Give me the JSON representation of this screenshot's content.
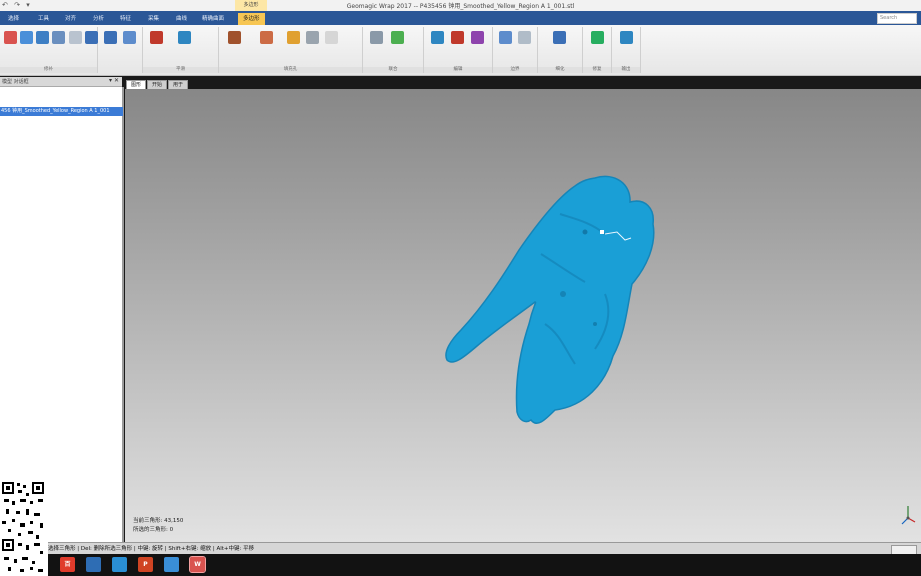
{
  "window": {
    "title": "Geomagic Wrap 2017 -- P435456 钟用_Smoothed_Yellow_Region A 1_001.stl",
    "context_tab_group": "多边形"
  },
  "quick_access": {
    "undo": "↶",
    "redo": "↷",
    "menu": "▾"
  },
  "ribbon_tabs": [
    "选择",
    "工具",
    "对齐",
    "分析",
    "特征",
    "采集",
    "曲线",
    "精确曲面",
    "多边形"
  ],
  "active_tab": "多边形",
  "search_placeholder": "Search",
  "ribbon_groups": [
    {
      "label": "修补",
      "buttons": [
        "",
        "",
        "",
        "",
        "",
        ""
      ]
    },
    {
      "label": "平滑",
      "buttons": [
        "",
        "",
        "",
        ""
      ]
    },
    {
      "label": "填充孔",
      "buttons": [
        "",
        "",
        "",
        "",
        "",
        "",
        ""
      ]
    },
    {
      "label": "联合",
      "buttons": [
        "",
        "",
        ""
      ]
    },
    {
      "label": "编辑",
      "buttons": [
        "",
        "",
        "",
        ""
      ]
    },
    {
      "label": "边界",
      "buttons": [
        "",
        "",
        ""
      ]
    },
    {
      "label": "细化",
      "buttons": [
        "",
        ""
      ]
    },
    {
      "label": "修复",
      "buttons": [
        ""
      ]
    },
    {
      "label": "输出",
      "buttons": [
        ""
      ]
    }
  ],
  "panel": {
    "tabs": "模型 对话框",
    "controls": "▾ ✕",
    "selected_item": "456 钟用_Smoothed_Yellow_Region A 1_001"
  },
  "view_tabs": [
    "图形",
    "开始",
    "用于"
  ],
  "viewport_stats": {
    "line1": "当前三角形: 43,150",
    "line2": "所选的三角形: 0"
  },
  "status_bar": "选择三角形 | Del: 删除所选三角形 | 中键: 旋转 | Shift+右键: 缩放 | Alt+中键: 平移",
  "taskbar_apps": [
    {
      "name": "baidu",
      "label": "百",
      "color": "#e03b2b"
    },
    {
      "name": "files",
      "label": "",
      "color": "#2e6db4"
    },
    {
      "name": "doc",
      "label": "",
      "color": "#2a8fd4"
    },
    {
      "name": "powerpoint",
      "label": "P",
      "color": "#d04423"
    },
    {
      "name": "app",
      "label": "",
      "color": "#3a8ed6"
    },
    {
      "name": "wps",
      "label": "W",
      "color": "#d9534f"
    }
  ],
  "colors": {
    "model": "#1a9fd6",
    "tabbar": "#2b5797",
    "active_tab": "#f7c653"
  }
}
